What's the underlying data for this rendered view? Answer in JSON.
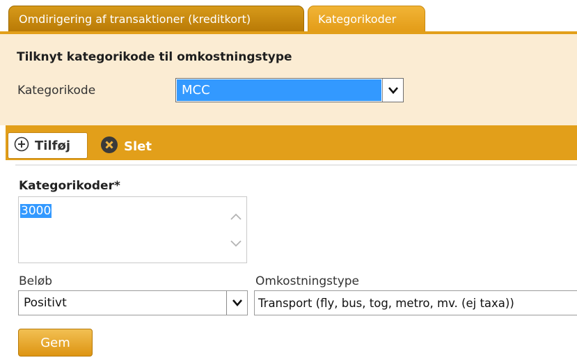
{
  "tabs": [
    {
      "label": "Omdirigering af transaktioner (kreditkort)"
    },
    {
      "label": "Kategorikoder"
    }
  ],
  "category_section": {
    "title": "Tilknyt kategorikode til omkostningstype",
    "field_label": "Kategorikode",
    "selected_value": "MCC"
  },
  "toolbar": {
    "add_label": "Tilføj",
    "delete_label": "Slet"
  },
  "form": {
    "codes_label": "Kategorikoder*",
    "codes_value": "3000",
    "amount_label": "Beløb",
    "amount_value": "Positivt",
    "expense_type_label": "Omkostningstype",
    "expense_type_value": "Transport (fly, bus, tog, metro, mv. (ej taxa))",
    "save_label": "Gem"
  },
  "colors": {
    "accent": "#e29f1a",
    "panel_bg": "#fbecd3",
    "selection": "#3399ff"
  },
  "icons": [
    "plus-circle-icon",
    "delete-circle-icon",
    "chevron-down-icon",
    "scroll-up-icon",
    "scroll-down-icon"
  ]
}
